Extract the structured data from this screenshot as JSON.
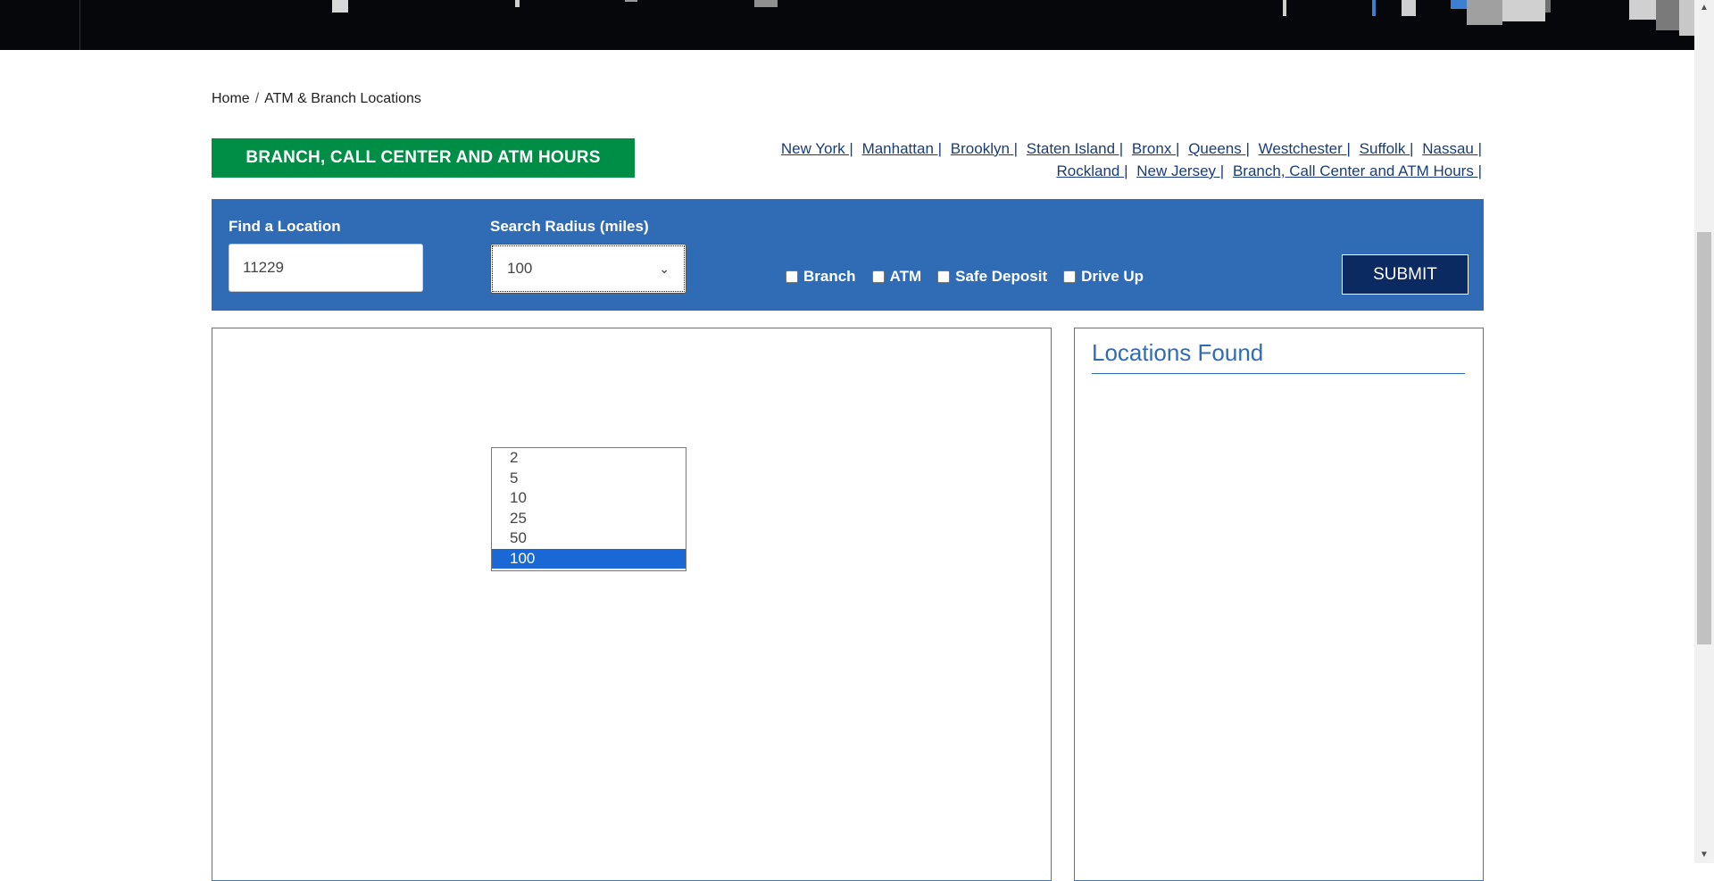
{
  "breadcrumb": {
    "home": "Home",
    "separator": "/",
    "current": "ATM & Branch Locations"
  },
  "hours_button": "BRANCH, CALL CENTER AND ATM HOURS",
  "region_links": [
    "New York |",
    "Manhattan |",
    "Brooklyn |",
    "Staten Island |",
    "Bronx |",
    "Queens |",
    "Westchester |",
    "Suffolk |",
    "Nassau |",
    "Rockland |",
    "New Jersey |",
    "Branch, Call Center and ATM Hours |"
  ],
  "search": {
    "find_label": "Find a Location",
    "location_value": "11229",
    "radius_label": "Search Radius (miles)",
    "radius_selected": "100",
    "radius_options": [
      "2",
      "5",
      "10",
      "25",
      "50",
      "100"
    ],
    "filters": [
      "Branch",
      "ATM",
      "Safe Deposit",
      "Drive Up"
    ],
    "submit_label": "SUBMIT"
  },
  "results": {
    "title": "Locations Found"
  },
  "colors": {
    "panel_blue": "#306cb6",
    "hours_green": "#008d45",
    "submit_navy": "#0b2a62",
    "link_navy": "#1a3d75"
  }
}
